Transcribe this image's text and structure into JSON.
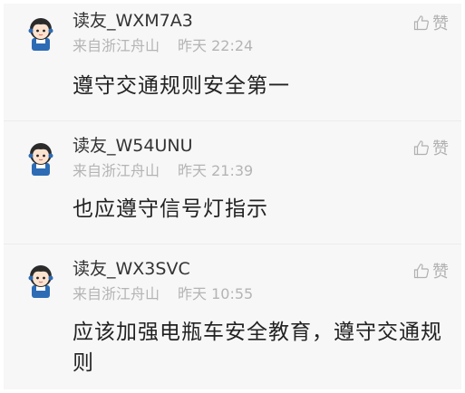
{
  "comments": [
    {
      "username": "读友_WXM7A3",
      "location": "来自浙江舟山",
      "time": "昨天 22:24",
      "like_label": "赞",
      "content": "遵守交通规则安全第一"
    },
    {
      "username": "读友_W54UNU",
      "location": "来自浙江舟山",
      "time": "昨天 21:39",
      "like_label": "赞",
      "content": "也应遵守信号灯指示"
    },
    {
      "username": "读友_WX3SVC",
      "location": "来自浙江舟山",
      "time": "昨天 10:55",
      "like_label": "赞",
      "content": "应该加强电瓶车安全教育，遵守交通规则"
    }
  ],
  "icons": {
    "avatar": "avatar-cartoon-girl-icon",
    "like": "thumbs-up-icon"
  },
  "colors": {
    "background": "#f7f7f7",
    "username": "#333333",
    "meta": "#b4b4b4",
    "content": "#222222",
    "avatar_accent": "#2d6cb5"
  }
}
